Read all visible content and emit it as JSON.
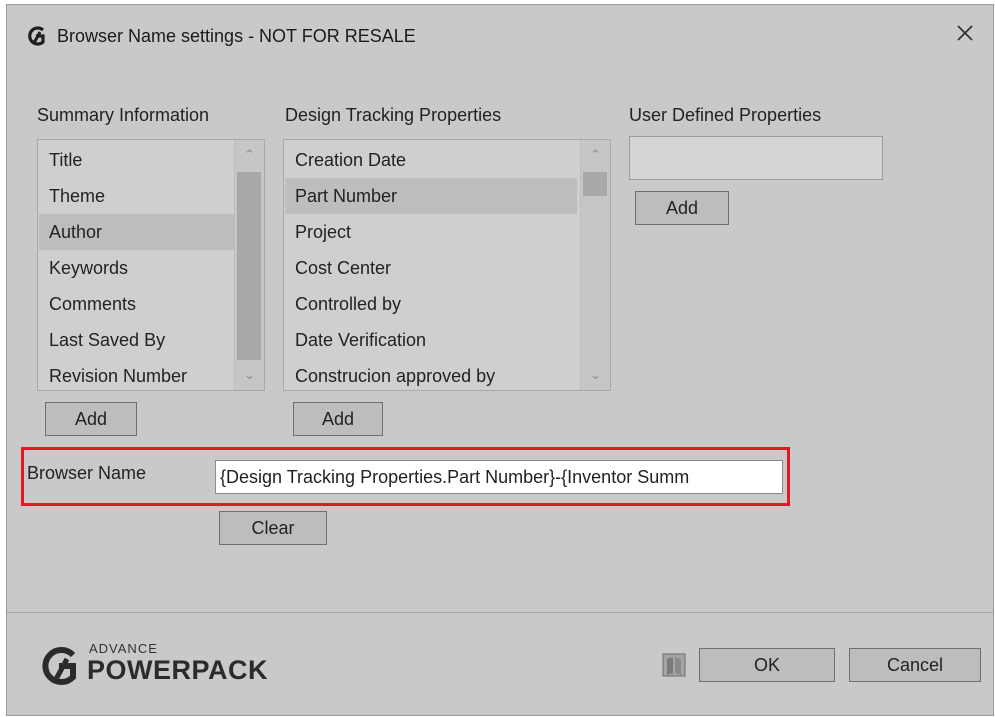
{
  "window": {
    "title": "Browser Name settings - NOT FOR RESALE"
  },
  "summary": {
    "label": "Summary Information",
    "items": [
      "Title",
      "Theme",
      "Author",
      "Keywords",
      "Comments",
      "Last Saved By",
      "Revision Number"
    ],
    "selected": "Author",
    "add_label": "Add"
  },
  "design": {
    "label": "Design Tracking Properties",
    "items": [
      "Creation Date",
      "Part Number",
      "Project",
      "Cost Center",
      "Controlled by",
      "Date Verification",
      "Construcion approved by"
    ],
    "selected": "Part Number",
    "add_label": "Add"
  },
  "user_defined": {
    "label": "User Defined Properties",
    "value": "",
    "add_label": "Add"
  },
  "browser_name": {
    "label": "Browser Name",
    "value": "{Design Tracking Properties.Part Number}-{Inventor Summ",
    "clear_label": "Clear"
  },
  "footer": {
    "brand_small": "ADVANCE",
    "brand_big": "POWERPACK",
    "ok_label": "OK",
    "cancel_label": "Cancel"
  },
  "colors": {
    "highlight": "#e01a22",
    "dialog_bg": "#c9c9c9"
  }
}
